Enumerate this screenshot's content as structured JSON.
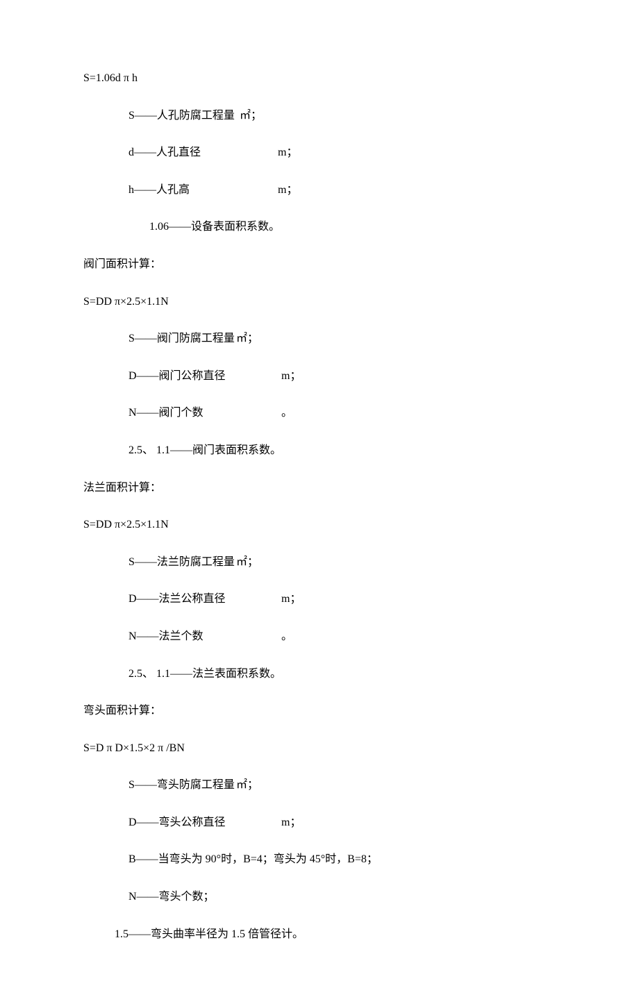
{
  "sec1": {
    "formula": "S=1.06d π h",
    "d1_label": "S——人孔防腐工程量",
    "d1_unit": "㎡；",
    "d2_label": "d——人孔直径",
    "d2_unit": "m；",
    "d3_label": "h——人孔高",
    "d3_unit": "m；",
    "d4": "1.06——设备表面积系数。"
  },
  "sec2": {
    "title": "阀门面积计算：",
    "formula": "S=DD π×2.5×1.1N",
    "d1_label": "S——阀门防腐工程量",
    "d1_unit": "㎡；",
    "d2_label": "D——阀门公称直径",
    "d2_unit": "m；",
    "d3_label": "N——阀门个数",
    "d3_unit": "。",
    "d4": "2.5、 1.1——阀门表面积系数。"
  },
  "sec3": {
    "title": "法兰面积计算：",
    "formula": "S=DD π×2.5×1.1N",
    "d1_label": "S——法兰防腐工程量",
    "d1_unit": "㎡；",
    "d2_label": "D——法兰公称直径",
    "d2_unit": "m；",
    "d3_label": "N——法兰个数",
    "d3_unit": "。",
    "d4": "2.5、 1.1——法兰表面积系数。"
  },
  "sec4": {
    "title": "弯头面积计算：",
    "formula": "S=D π D×1.5×2 π /BN",
    "d1_label": "S——弯头防腐工程量",
    "d1_unit": "㎡；",
    "d2_label": "D——弯头公称直径",
    "d2_unit": "m；",
    "d3": "B——当弯头为 90°时，B=4；弯头为 45°时，B=8；",
    "d4": "N——弯头个数；",
    "d5": "1.5——弯头曲率半径为 1.5 倍管径计。"
  }
}
